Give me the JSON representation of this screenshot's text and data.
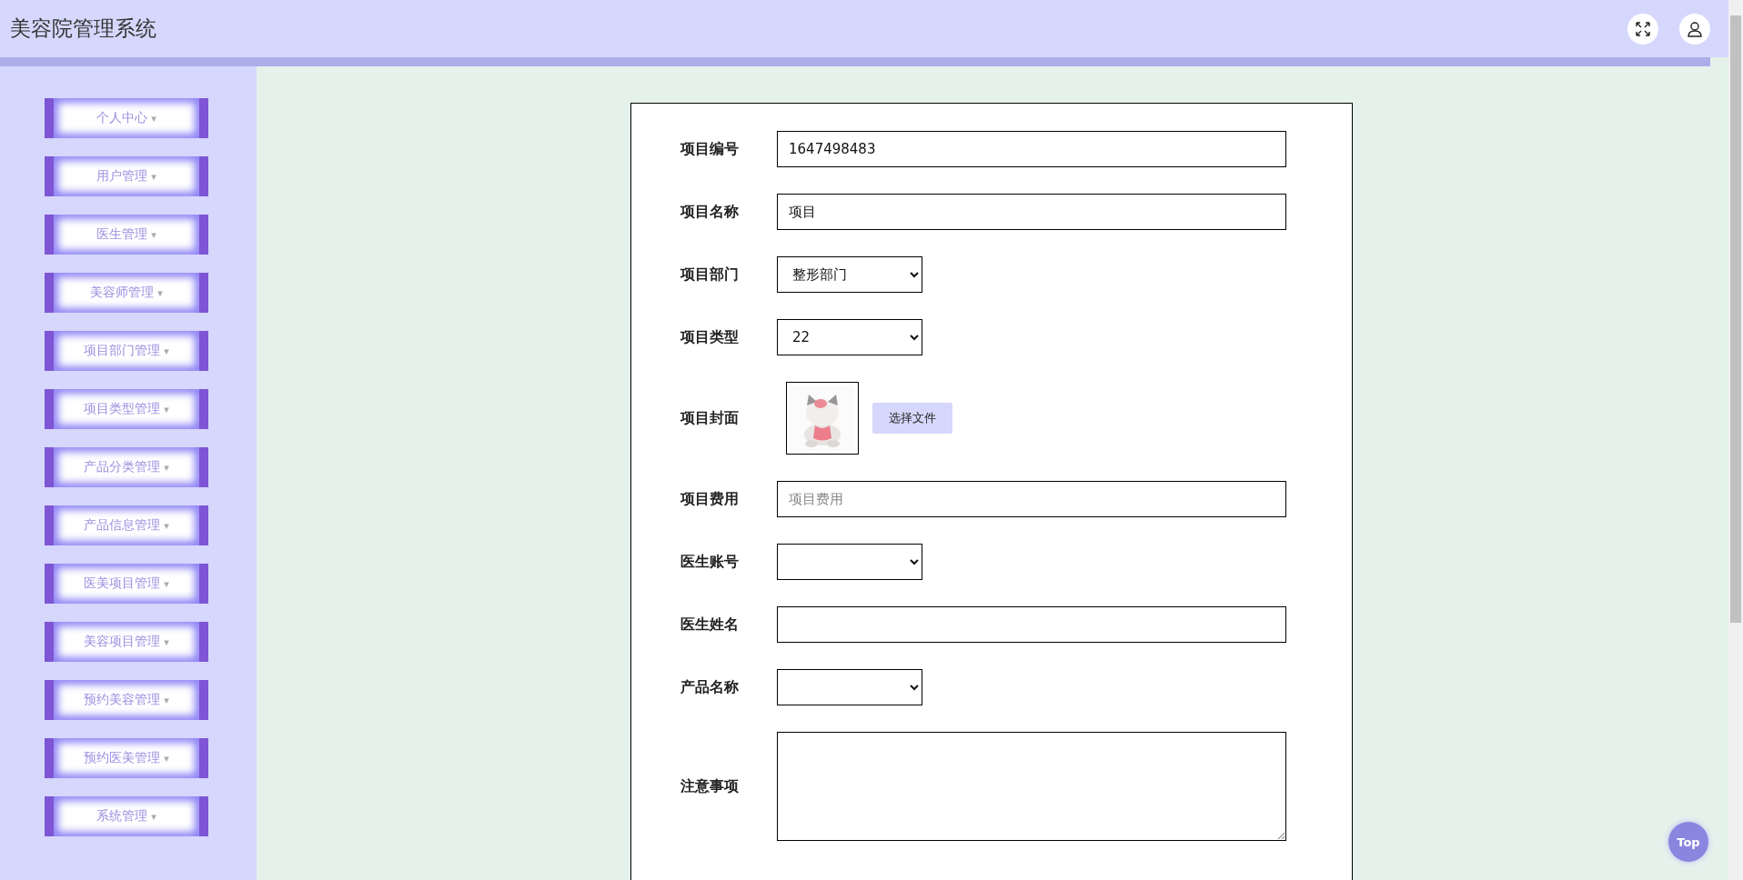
{
  "header": {
    "title": "美容院管理系统"
  },
  "sidebar": {
    "items": [
      {
        "label": "个人中心",
        "caret": "▾"
      },
      {
        "label": "用户管理",
        "caret": "▾"
      },
      {
        "label": "医生管理",
        "caret": "▾"
      },
      {
        "label": "美容师管理",
        "caret": "▾"
      },
      {
        "label": "项目部门管理",
        "caret": "▾"
      },
      {
        "label": "项目类型管理",
        "caret": "▾"
      },
      {
        "label": "产品分类管理",
        "caret": "▾"
      },
      {
        "label": "产品信息管理",
        "caret": "▾"
      },
      {
        "label": "医美项目管理",
        "caret": "▾"
      },
      {
        "label": "美容项目管理",
        "caret": "▾"
      },
      {
        "label": "预约美容管理",
        "caret": "▾"
      },
      {
        "label": "预约医美管理",
        "caret": "▾"
      },
      {
        "label": "系统管理",
        "caret": "▾"
      }
    ]
  },
  "form": {
    "fields": [
      {
        "kind": "text",
        "label": "项目编号",
        "value": "1647498483"
      },
      {
        "kind": "text",
        "label": "项目名称",
        "value": "项目"
      },
      {
        "kind": "select",
        "label": "项目部门",
        "value": "整形部门"
      },
      {
        "kind": "select",
        "label": "项目类型",
        "value": "22"
      },
      {
        "kind": "file",
        "label": "项目封面",
        "button": "选择文件"
      },
      {
        "kind": "text",
        "label": "项目费用",
        "placeholder": "项目费用"
      },
      {
        "kind": "select",
        "label": "医生账号"
      },
      {
        "kind": "text",
        "label": "医生姓名"
      },
      {
        "kind": "select",
        "label": "产品名称"
      },
      {
        "kind": "textarea",
        "label": "注意事项"
      }
    ]
  },
  "top_button": "Top"
}
